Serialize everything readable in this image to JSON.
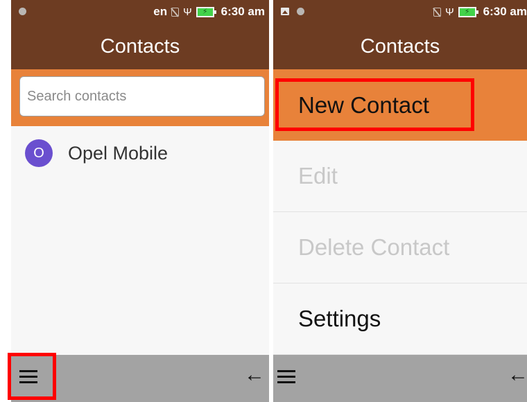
{
  "left_screen": {
    "status": {
      "lang": "en",
      "time": "6:30 am"
    },
    "app_title": "Contacts",
    "search": {
      "placeholder": "Search contacts",
      "value": ""
    },
    "contacts": [
      {
        "initial": "O",
        "name": "Opel Mobile"
      }
    ],
    "bottom_bar": {
      "menu_icon": "hamburger-icon",
      "back_icon": "back-arrow-icon",
      "back_glyph": "←"
    }
  },
  "right_screen": {
    "status": {
      "time": "6:30 am"
    },
    "app_title": "Contacts",
    "menu_items": [
      {
        "label": "New Contact",
        "state": "selected"
      },
      {
        "label": "Edit",
        "state": "disabled"
      },
      {
        "label": "Delete Contact",
        "state": "disabled"
      },
      {
        "label": "Settings",
        "state": "enabled"
      }
    ],
    "bottom_bar": {
      "menu_icon": "hamburger-icon",
      "back_icon": "back-arrow-icon",
      "back_glyph": "←"
    }
  },
  "colors": {
    "app_bar": "#6d3c22",
    "accent_orange": "#e8823a",
    "avatar": "#6a4fcf",
    "bottom_bar": "#a3a3a3",
    "highlight": "#ff0000",
    "battery": "#42d34a"
  }
}
